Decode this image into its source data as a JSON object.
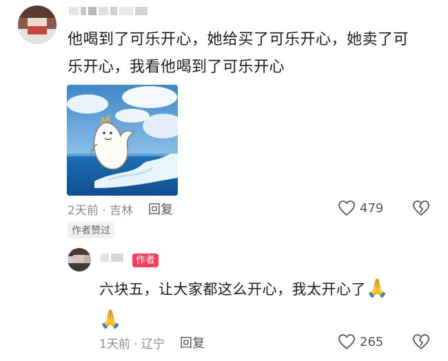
{
  "comment1": {
    "text_line1": "他喝到了可乐开心，她给买了可乐开心，她卖了可",
    "text_line2": "乐开心，我看他喝到了可乐开心",
    "time_location": "2天前 · 吉林",
    "reply_label": "回复",
    "like_count": "479",
    "author_liked_badge": "作者赞过"
  },
  "comment2": {
    "author_tag": "作者",
    "text_line1": "六块五，让大家都这么开心，我太开心了",
    "emoji": "🙏",
    "time_location": "1天前 · 辽宁",
    "reply_label": "回复",
    "like_count": "265"
  },
  "icons": {
    "like": "heart-outline-icon",
    "dislike": "broken-heart-icon"
  },
  "colors": {
    "author_tag_bg": "#ff3b5c",
    "meta_text": "#8a8a8a",
    "text": "#1b1b1b"
  }
}
